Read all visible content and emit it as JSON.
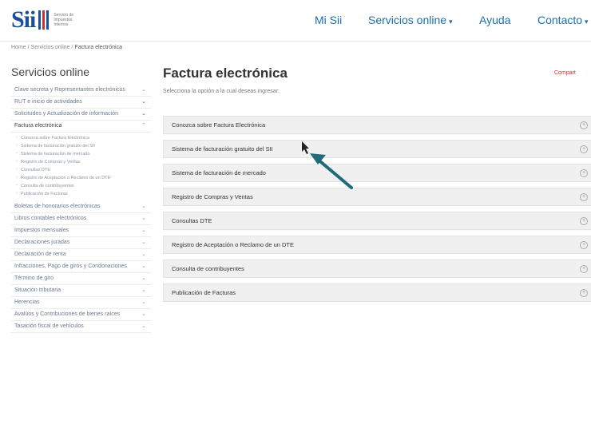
{
  "header": {
    "logo_text": "Sii",
    "logo_subtitle": "Servicio de Impuestos Internos",
    "nav": {
      "mi_sii": "Mi Sii",
      "servicios_online": "Servicios online",
      "ayuda": "Ayuda",
      "contacto": "Contacto"
    }
  },
  "breadcrumb": {
    "items": [
      "Home",
      "Servicios online",
      "Factura electrónica"
    ],
    "separator": "/"
  },
  "sidebar": {
    "title": "Servicios online",
    "items": [
      {
        "label": "Clave secreta y Representantes electrónicos"
      },
      {
        "label": "RUT e inicio de actividades"
      },
      {
        "label": "Solicitudes y Actualización de información"
      },
      {
        "label": "Factura electrónica",
        "expanded": true
      },
      {
        "label": "Boletas de honorarios electrónicas"
      },
      {
        "label": "Libros contables electrónicos"
      },
      {
        "label": "Impuestos mensuales"
      },
      {
        "label": "Declaraciones juradas"
      },
      {
        "label": "Declaración de renta"
      },
      {
        "label": "Infracciones, Pago de giros y Condonaciones"
      },
      {
        "label": "Término de giro"
      },
      {
        "label": "Situación tributaria"
      },
      {
        "label": "Herencias"
      },
      {
        "label": "Avalúos y Contribuciones de bienes raíces"
      },
      {
        "label": "Tasación fiscal de vehículos"
      }
    ],
    "subitems": [
      "Conozca sobre Factura Electrónica",
      "Sistema de facturación gratuito del SII",
      "Sistema de facturación de mercado",
      "Registro de Compras y Ventas",
      "Consultas DTE",
      "Registro de Aceptación o Reclamo de un DTE",
      "Consulta de contribuyentes",
      "Publicación de Facturas"
    ]
  },
  "main": {
    "title": "Factura electrónica",
    "subtitle": "Selecciona la opción a la cual deseas ingresar:",
    "share": "Compart",
    "options": [
      "Conozca sobre Factura Electrónica",
      "Sistema de facturación gratuito del SII",
      "Sistema de facturación de mercado",
      "Registro de Compras y Ventas",
      "Consultas DTE",
      "Registro de Aceptación o Reclamo de un DTE",
      "Consulta de contribuyentes",
      "Publicación de Facturas"
    ]
  },
  "icons": {
    "caret": "▾",
    "chevron": "⌄",
    "plus": "+"
  },
  "colors": {
    "brand_blue": "#1a4f9c",
    "brand_red": "#d0312d",
    "link": "#1a6fae",
    "annotation_arrow": "#1f6b7a"
  }
}
